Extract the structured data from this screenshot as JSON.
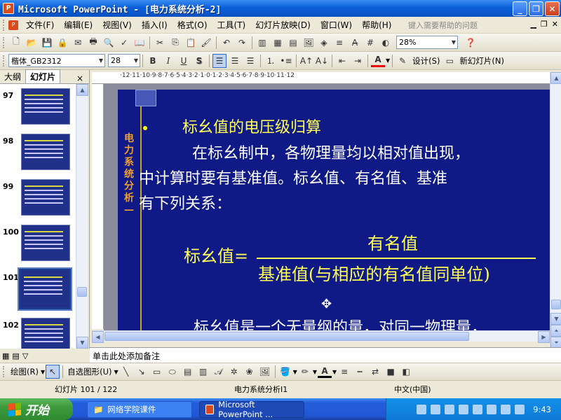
{
  "window": {
    "app_icon_text": "P",
    "title": "Microsoft PowerPoint - [电力系统分析-2]",
    "minimize": "_",
    "restore": "❐",
    "close": "✕"
  },
  "menu": {
    "items": [
      "文件(F)",
      "编辑(E)",
      "视图(V)",
      "插入(I)",
      "格式(O)",
      "工具(T)",
      "幻灯片放映(D)",
      "窗口(W)",
      "帮助(H)"
    ],
    "help_placeholder": "键入需要帮助的问题"
  },
  "standard_toolbar": {
    "zoom": "28%"
  },
  "format_toolbar": {
    "font_name": "楷体_GB2312",
    "font_size": "28",
    "bold": "B",
    "italic": "I",
    "underline": "U",
    "shadow": "S",
    "font_color_label": "A",
    "design_label": "设计(S)",
    "new_slide_label": "新幻灯片(N)"
  },
  "left_panel": {
    "tabs": [
      "大纲",
      "幻灯片"
    ],
    "close": "×",
    "slides": [
      {
        "num": "97",
        "selected": false
      },
      {
        "num": "98",
        "selected": false
      },
      {
        "num": "99",
        "selected": false
      },
      {
        "num": "100",
        "selected": false
      },
      {
        "num": "101",
        "selected": true
      },
      {
        "num": "102",
        "selected": false
      }
    ]
  },
  "ruler": {
    "text": "·12·11·10·9·8·7·6·5·4·3·2·1·0·1·2·3·4·5·6·7·8·9·10·11·12"
  },
  "slide": {
    "vertical_title": "电力系统分析—",
    "heading": "标幺值的电压级归算",
    "paragraph_lines": [
      "　　在标幺制中，各物理量均以相对值出现，",
      "中计算时要有基准值。标幺值、有名值、基准",
      "有下列关系："
    ],
    "formula_label": "标幺值=",
    "numerator": "有名值",
    "denominator": "基准值(与相应的有名值同单位)",
    "bottom_line": "标幺值是一个无量纲的量，对同一物理量，"
  },
  "notes": {
    "placeholder": "单击此处添加备注"
  },
  "draw_toolbar": {
    "draw_label": "绘图(R)",
    "autoshapes_label": "自选图形(U)"
  },
  "status": {
    "slide_position": "幻灯片 101 / 122",
    "design": "电力系统分析I1",
    "language": "中文(中国)"
  },
  "taskbar": {
    "start": "开始",
    "tasks": [
      "网络学院课件",
      "Microsoft PowerPoint ..."
    ],
    "clock": "9:43"
  }
}
